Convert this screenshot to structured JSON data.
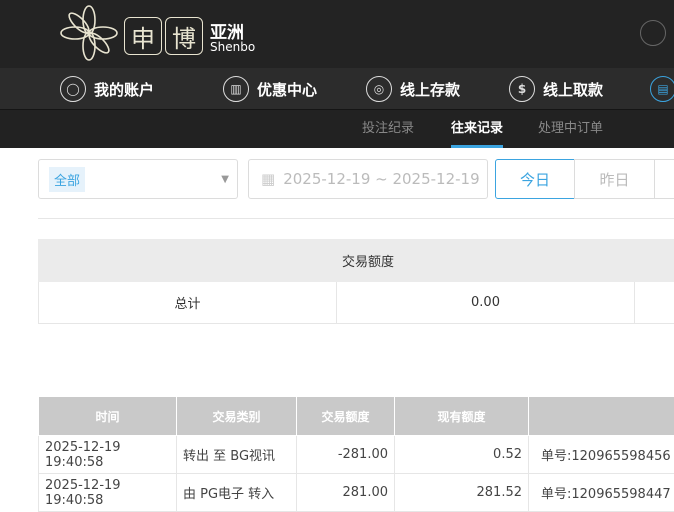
{
  "brand": {
    "char1": "申",
    "char2": "博",
    "region": "亚洲",
    "latin": "Shenbo"
  },
  "nav": [
    {
      "label": "我的账户",
      "icon": "user-icon"
    },
    {
      "label": "优惠中心",
      "icon": "gift-icon"
    },
    {
      "label": "线上存款",
      "icon": "deposit-icon"
    },
    {
      "label": "线上取款",
      "icon": "withdraw-icon"
    }
  ],
  "subnav": [
    {
      "label": "投注纪录"
    },
    {
      "label": "往来记录",
      "active": true
    },
    {
      "label": "处理中订单"
    }
  ],
  "filter": {
    "type_value": "全部",
    "date_range": "2025-12-19 ~ 2025-12-19",
    "quick": [
      "今日",
      "昨日"
    ]
  },
  "summary": {
    "header": "交易额度",
    "row_label": "总计",
    "amount": "0.00"
  },
  "table": {
    "headers": [
      "时间",
      "交易类别",
      "交易额度",
      "现有额度",
      ""
    ],
    "rows": [
      [
        "2025-12-19 19:40:58",
        "转出 至 BG视讯",
        "-281.00",
        "0.52",
        "单号:120965598456"
      ],
      [
        "2025-12-19 19:40:58",
        "由 PG电子 转入",
        "281.00",
        "281.52",
        "单号:120965598447"
      ]
    ]
  },
  "colors": {
    "accent": "#3ba4e0",
    "header_bg": "#232323"
  }
}
